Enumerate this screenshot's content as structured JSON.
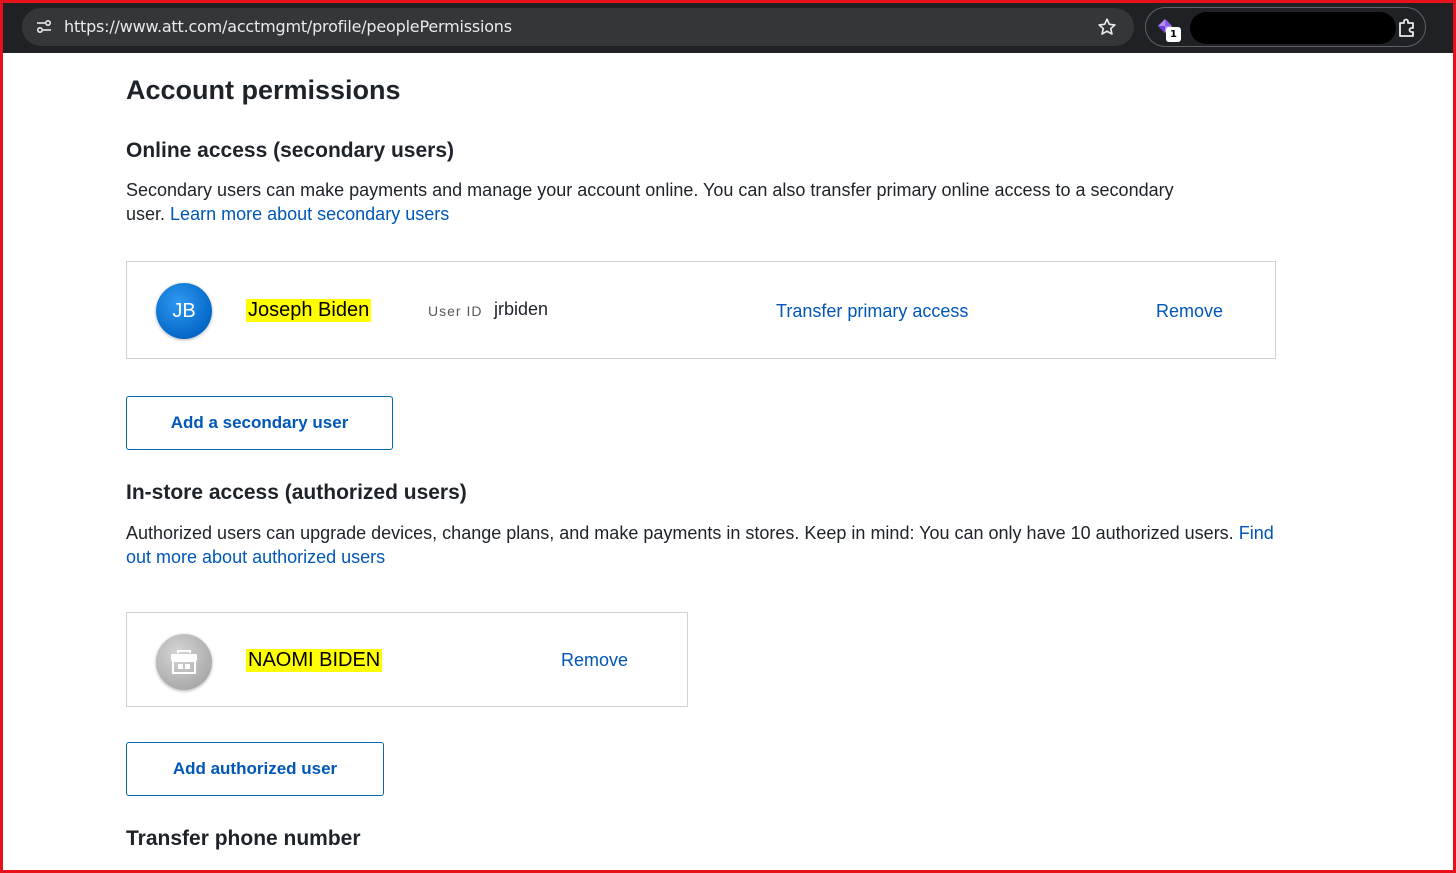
{
  "browser": {
    "url": "https://www.att.com/acctmgmt/profile/peoplePermissions",
    "extension_badge": "1",
    "icons": [
      "site-info-icon",
      "bookmark-star-icon",
      "extension-icon",
      "puzzle-icon"
    ]
  },
  "page": {
    "title": "Account permissions"
  },
  "online_access": {
    "title": "Online access (secondary users)",
    "description": "Secondary users can make payments and manage your account online. You can also transfer primary online access to a secondary user.",
    "learn_more_link": "Learn more about secondary users",
    "user": {
      "initials": "JB",
      "name": "Joseph Biden",
      "user_id_label": "User ID",
      "user_id": "jrbiden",
      "transfer_link": "Transfer primary access",
      "remove_link": "Remove"
    },
    "add_button": "Add a secondary user"
  },
  "instore_access": {
    "title": "In-store access (authorized users)",
    "description": "Authorized users can upgrade devices, change plans, and make payments in stores. Keep in mind: You can only have 10 authorized users.",
    "find_out_link": "Find out more about authorized users",
    "user": {
      "avatar_icon": "store-icon",
      "name": "NAOMI BIDEN",
      "remove_link": "Remove"
    },
    "add_button": "Add authorized user"
  },
  "transfer": {
    "title": "Transfer phone number"
  },
  "colors": {
    "link": "#0057b8",
    "highlight": "#ffff00",
    "frame": "#e8101a",
    "toolbar": "#202124"
  }
}
